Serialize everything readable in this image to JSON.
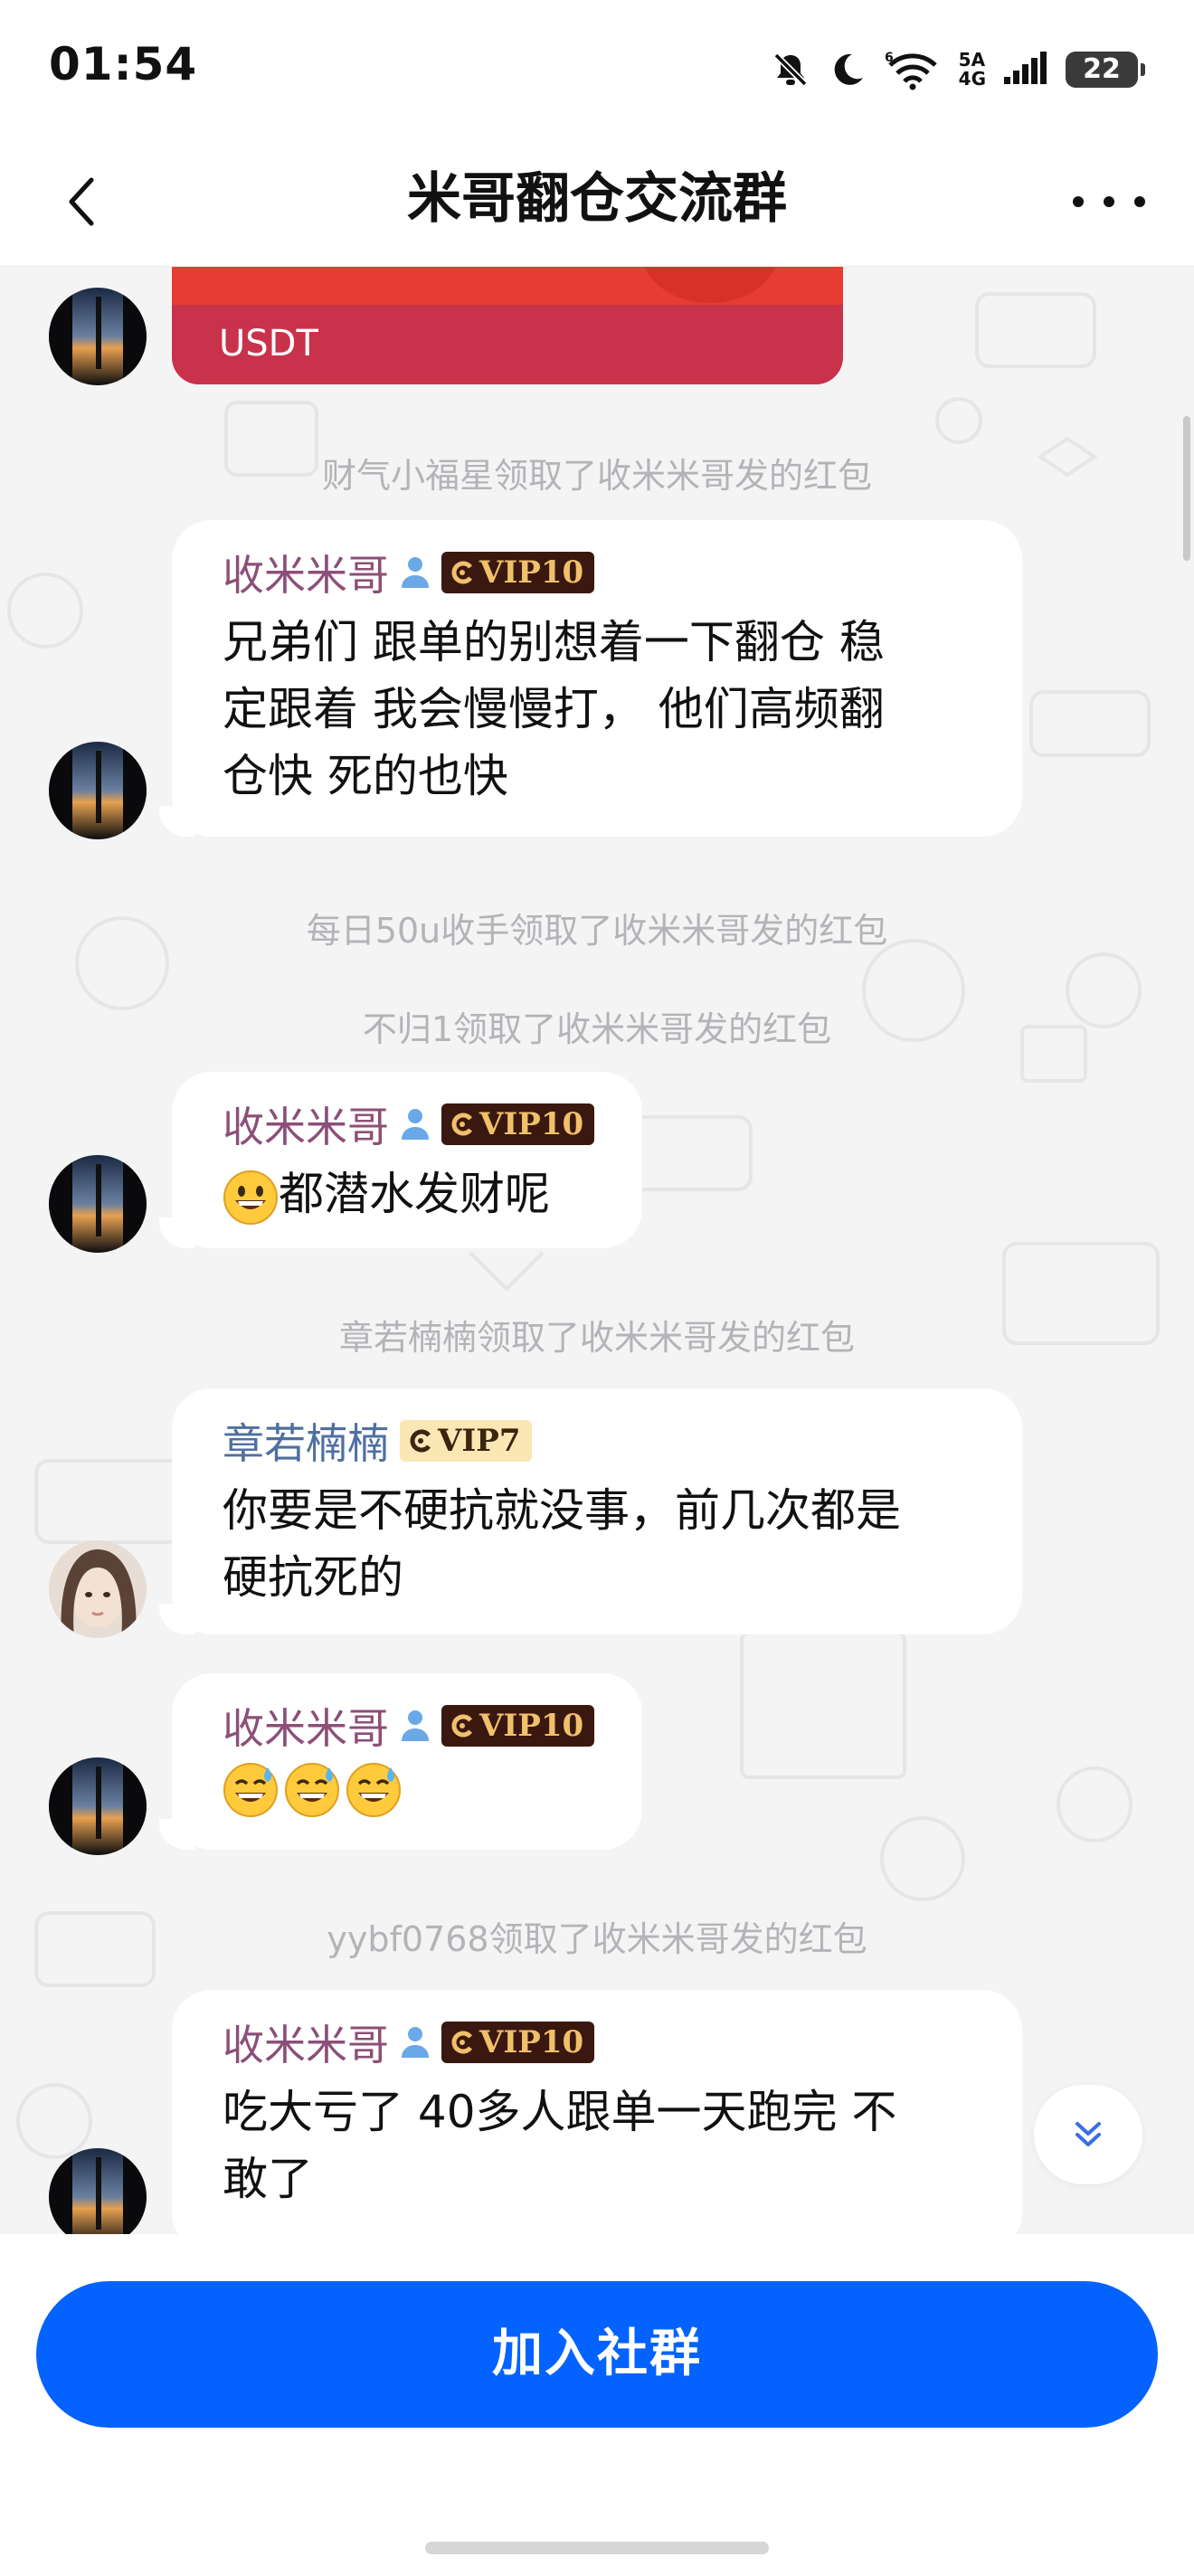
{
  "status_bar": {
    "time": "01:54",
    "network_top": "5A",
    "network_bottom": "4G",
    "battery": "22",
    "icons": [
      "bell-off-icon",
      "moon-icon",
      "wifi-6-icon",
      "signal-icon",
      "battery-icon"
    ]
  },
  "header": {
    "title": "米哥翻仓交流群",
    "back_icon": "chevron-left-icon",
    "more_icon": "more-dots-icon"
  },
  "chat": {
    "red_packet": {
      "label": "USDT"
    },
    "system_messages": [
      "财气小福星领取了收米米哥发的红包",
      "每日50u收手领取了收米米哥发的红包",
      "不归1领取了收米米哥发的红包",
      "章若楠楠领取了收米米哥发的红包",
      "yybf0768领取了收米米哥发的红包"
    ],
    "messages": [
      {
        "sender": "收米米哥",
        "vip": "VIP10",
        "text": [
          "兄弟们 跟单的别想着一下翻仓 稳",
          "定跟着  我会慢慢打，  他们高频翻",
          "仓快 死的也快"
        ]
      },
      {
        "sender": "收米米哥",
        "vip": "VIP10",
        "text": [
          "都潜水发财呢"
        ],
        "emoji": "grinning-face"
      },
      {
        "sender": "章若楠楠",
        "vip": "VIP7",
        "text": [
          "你要是不硬抗就没事，前几次都是",
          "硬抗死的"
        ]
      },
      {
        "sender": "收米米哥",
        "vip": "VIP10",
        "text": [],
        "emoji": "sweat-smile-face x3"
      },
      {
        "sender": "收米米哥",
        "vip": "VIP10",
        "text": [
          "吃大亏了 40多人跟单一天跑完 不",
          "敢了"
        ]
      }
    ]
  },
  "footer": {
    "join_label": "加入社群"
  },
  "colors": {
    "accent": "#0463ff",
    "sender_name": "#8c4f78",
    "sender_name_alt": "#4f6fa0",
    "vip_badge_bg": "#3a1810",
    "vip_badge_text": "#f0c06a",
    "red_packet": "#c8324a",
    "chat_bg": "#f4f4f5"
  }
}
